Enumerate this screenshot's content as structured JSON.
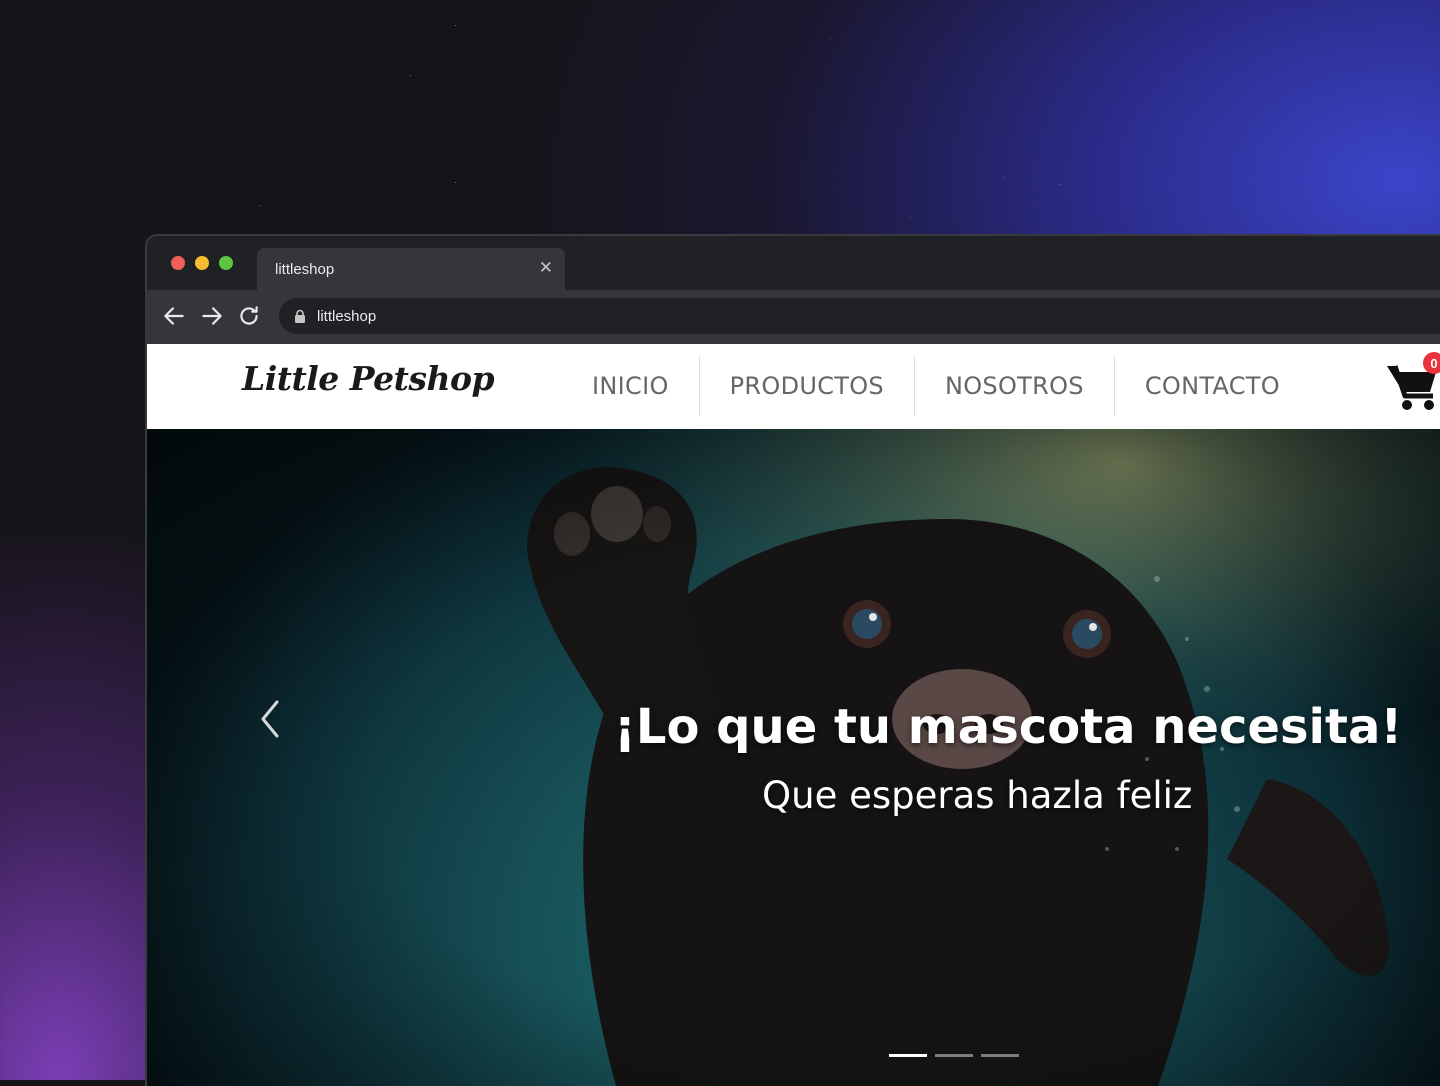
{
  "browser": {
    "tab_title": "littleshop",
    "url": "littleshop"
  },
  "site": {
    "logo": "Little Petshop",
    "menu": [
      {
        "label": "INICIO"
      },
      {
        "label": "PRODUCTOS"
      },
      {
        "label": "NOSOTROS"
      },
      {
        "label": "CONTACTO"
      }
    ],
    "cart_count": "0"
  },
  "hero": {
    "title": "¡Lo que tu mascota necesita!",
    "subtitle": "Que esperas hazla feliz",
    "slides": 3,
    "active_slide": 1
  },
  "colors": {
    "cart_badge": "#e8323c",
    "hero_water": "#164f55"
  }
}
